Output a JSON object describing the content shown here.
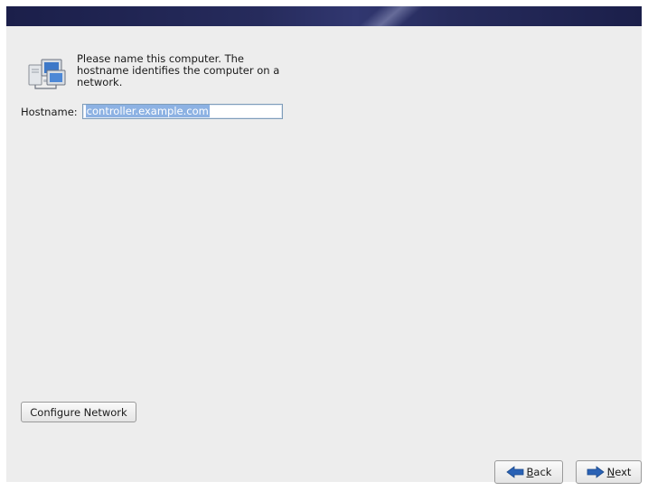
{
  "intro": {
    "text": "Please name this computer.  The hostname identifies the computer on a network."
  },
  "hostname": {
    "label": "Hostname:",
    "value": "controller.example.com"
  },
  "buttons": {
    "configure_network": "Configure Network",
    "back_accel": "B",
    "back_rest": "ack",
    "next_accel": "N",
    "next_rest": "ext"
  },
  "icons": {
    "computer": "network-computer-icon",
    "back": "arrow-left-icon",
    "next": "arrow-right-icon"
  },
  "colors": {
    "banner": "#1b1f4a",
    "panel": "#ededed",
    "selection": "#8db2e3",
    "arrow": "#2a62b5"
  }
}
